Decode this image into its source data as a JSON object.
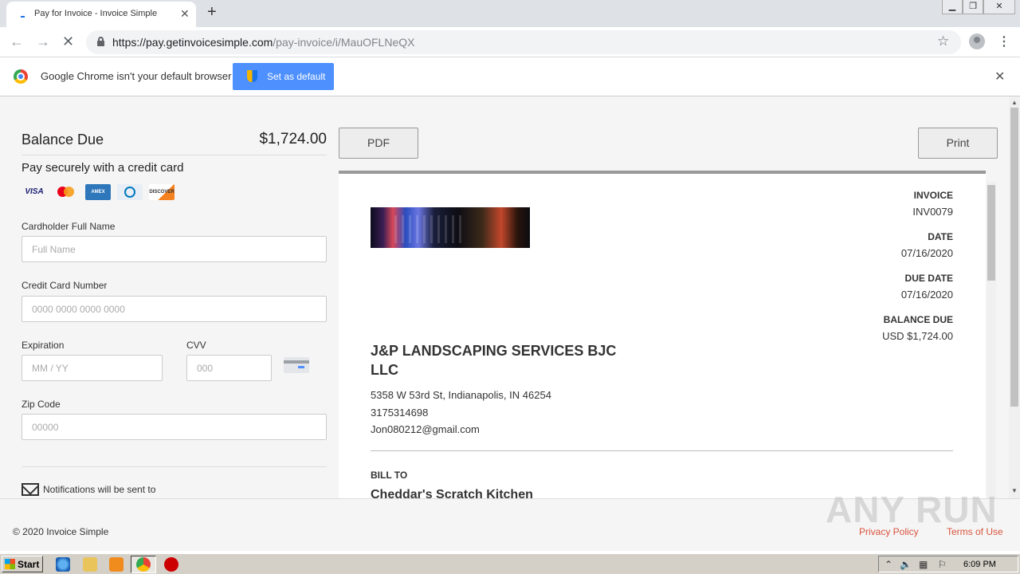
{
  "browser": {
    "tab_title": "Pay for Invoice - Invoice Simple",
    "url_host": "https://pay.getinvoicesimple.com",
    "url_path": "/pay-invoice/i/MauOFLNeQX",
    "infobar_text": "Google Chrome isn't your default browser",
    "set_default_label": "Set as default"
  },
  "payment": {
    "balance_label": "Balance Due",
    "balance_amount": "$1,724.00",
    "pay_securely": "Pay securely with a credit card",
    "cards": [
      "VISA",
      "mastercard",
      "AMEX",
      "diners",
      "DISCOVER"
    ],
    "fields": {
      "name_label": "Cardholder Full Name",
      "name_placeholder": "Full Name",
      "cc_label": "Credit Card Number",
      "cc_placeholder": "0000 0000 0000 0000",
      "exp_label": "Expiration",
      "exp_placeholder": "MM / YY",
      "cvv_label": "CVV",
      "cvv_placeholder": "000",
      "zip_label": "Zip Code",
      "zip_placeholder": "00000"
    },
    "notifications": "Notifications will be sent to"
  },
  "actions": {
    "pdf_label": "PDF",
    "print_label": "Print"
  },
  "invoice": {
    "invoice_label": "INVOICE",
    "invoice_number": "INV0079",
    "date_label": "DATE",
    "date": "07/16/2020",
    "due_label": "DUE DATE",
    "due_date": "07/16/2020",
    "balance_label": "BALANCE DUE",
    "balance": "USD $1,724.00",
    "company_line1": "J&P LANDSCAPING SERVICES BJC",
    "company_line2": "LLC",
    "address": "5358 W 53rd St, Indianapolis, IN 46254",
    "phone": "3175314698",
    "email": "Jon080212@gmail.com",
    "bill_to_label": "BILL TO",
    "client": "Cheddar's Scratch Kitchen"
  },
  "footer": {
    "copyright": "© 2020 Invoice Simple",
    "privacy": "Privacy Policy",
    "terms": "Terms of Use"
  },
  "watermark": "ANY RUN",
  "taskbar": {
    "start_label": "Start",
    "clock": "6:09 PM"
  },
  "colors": {
    "accent": "#4d90fe",
    "link": "#d9533c"
  }
}
